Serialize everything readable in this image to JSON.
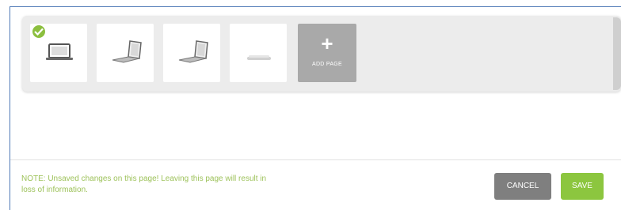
{
  "thumbnails": [
    {
      "name": "thumb-1",
      "selected": true,
      "icon": "laptop-front-icon"
    },
    {
      "name": "thumb-2",
      "selected": false,
      "icon": "laptop-angled-icon"
    },
    {
      "name": "thumb-3",
      "selected": false,
      "icon": "laptop-angled-icon"
    },
    {
      "name": "thumb-4",
      "selected": false,
      "icon": "laptop-closed-icon"
    }
  ],
  "add_page": {
    "icon": "+",
    "label": "ADD PAGE"
  },
  "note": {
    "text": "NOTE: Unsaved changes on this page! Leaving this page will result in loss of information."
  },
  "buttons": {
    "cancel_label": "CANCEL",
    "save_label": "SAVE"
  },
  "colors": {
    "accent_green": "#8cc63f",
    "cancel_gray": "#7f7f7f",
    "note_green": "#9dc25a",
    "frame_blue": "#4f79b6"
  }
}
